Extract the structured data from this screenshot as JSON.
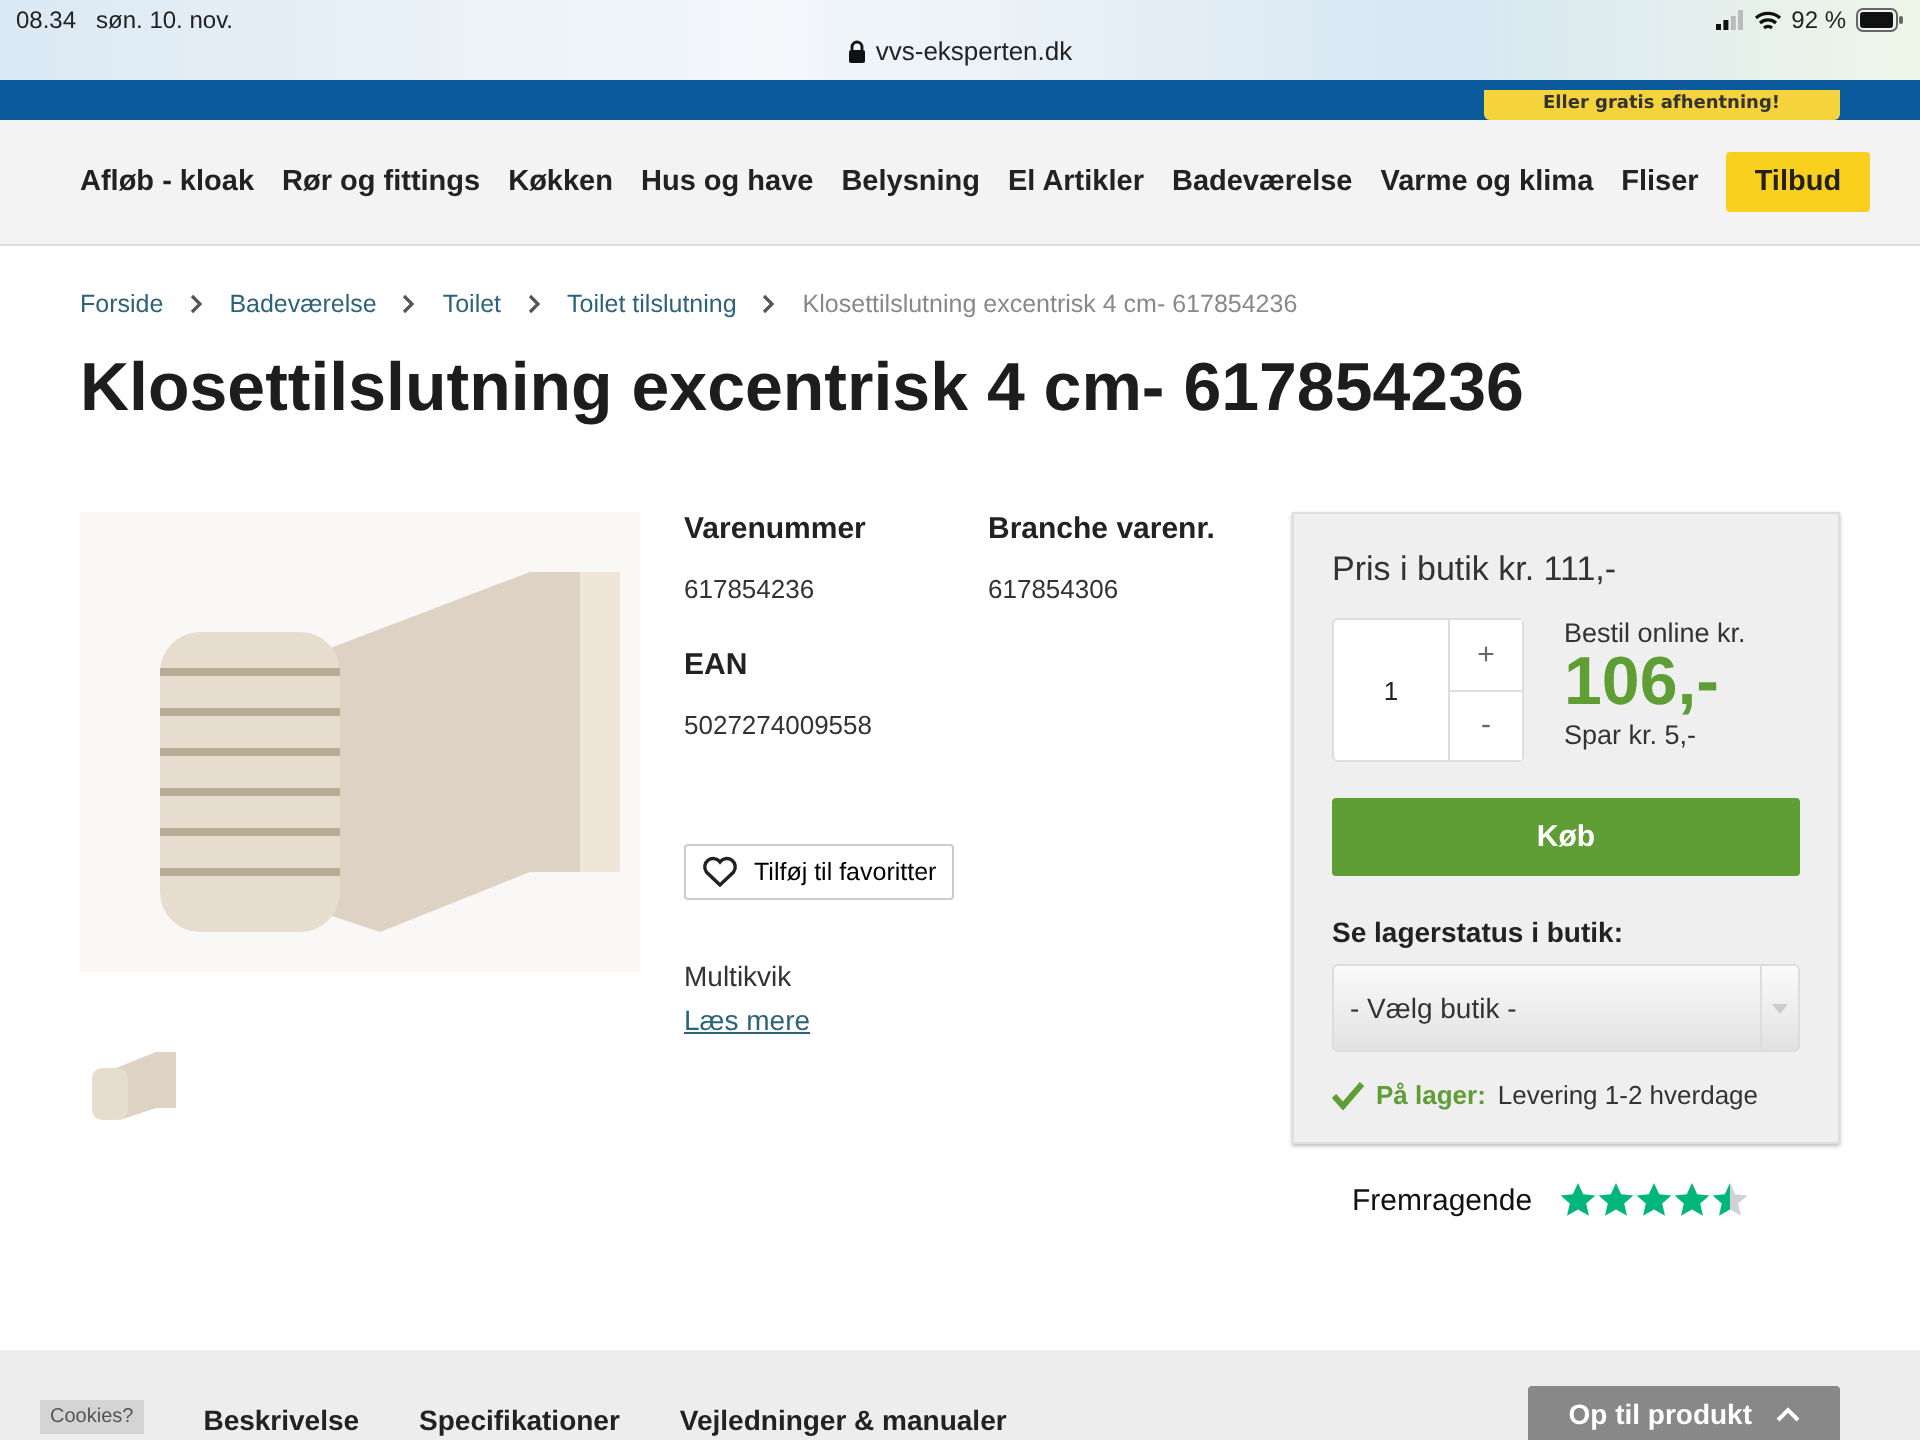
{
  "status_bar": {
    "time": "08.34",
    "date": "søn. 10. nov.",
    "url": "vvs-eksperten.dk",
    "battery": "92 %"
  },
  "promo": {
    "label": "Eller gratis afhentning!"
  },
  "nav": {
    "items": [
      {
        "label": "Afløb - kloak",
        "kind": "link"
      },
      {
        "label": "Rør og fittings",
        "kind": "link"
      },
      {
        "label": "Køkken",
        "kind": "link"
      },
      {
        "label": "Hus og have",
        "kind": "link"
      },
      {
        "label": "Belysning",
        "kind": "link"
      },
      {
        "label": "El Artikler",
        "kind": "link"
      },
      {
        "label": "Badeværelse",
        "kind": "link"
      },
      {
        "label": "Varme og klima",
        "kind": "link"
      },
      {
        "label": "Fliser",
        "kind": "link"
      },
      {
        "label": "Tilbud",
        "kind": "highlight"
      }
    ]
  },
  "breadcrumb": [
    {
      "label": "Forside",
      "current": false
    },
    {
      "label": "Badeværelse",
      "current": false
    },
    {
      "label": "Toilet",
      "current": false
    },
    {
      "label": "Toilet tilslutning",
      "current": false
    },
    {
      "label": "Klosettilslutning excentrisk 4 cm- 617854236",
      "current": true
    }
  ],
  "title": "Klosettilslutning excentrisk 4 cm- 617854236",
  "specs": [
    {
      "label": "Varenummer",
      "value": "617854236"
    },
    {
      "label": "Branche varenr.",
      "value": "617854306"
    },
    {
      "label": "EAN",
      "value": "5027274009558"
    }
  ],
  "favorite_button": "Tilføj til favoritter",
  "description": "Multikvik",
  "read_more": "Læs mere",
  "buy_box": {
    "store_price": "Pris i butik kr. 111,-",
    "quantity": "1",
    "plus": "+",
    "minus": "-",
    "online_label": "Bestil online kr.",
    "online_price": "106,-",
    "saving": "Spar kr. 5,-",
    "buy_button": "Køb",
    "stock_heading": "Se lagerstatus i butik:",
    "store_select": "- Vælg butik -",
    "stock_status": "På lager:",
    "delivery": "Levering 1-2 hverdage"
  },
  "rating": {
    "label": "Fremragende",
    "stars": 4.5
  },
  "bottom_tabs": [
    {
      "label": "Beskrivelse"
    },
    {
      "label": "Specifikationer"
    },
    {
      "label": "Vejledninger & manualer"
    }
  ],
  "cookie_badge": "Cookies?",
  "back_to_product": "Op til produkt"
}
